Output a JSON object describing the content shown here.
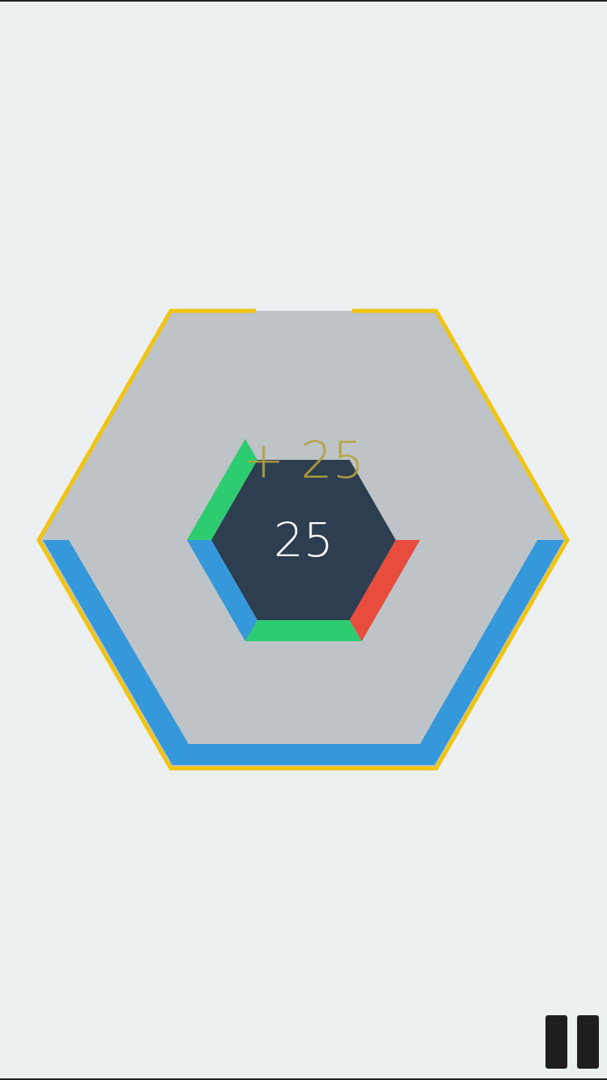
{
  "game": {
    "score": "25",
    "score_popup": "+ 25"
  },
  "colors": {
    "background": "#ECF0F1",
    "outer_hex_fill": "#BDC3C7",
    "outer_hex_border": "#F1C40F",
    "center_hex": "#2C3E50",
    "score_text": "#FFFFFF",
    "popup_text": "#B7A13A",
    "blue": "#3498DB",
    "green": "#2ECC71",
    "red": "#E74C3C",
    "pause_button": "#1E1E1E"
  },
  "icons": {
    "pause": "pause-icon"
  }
}
